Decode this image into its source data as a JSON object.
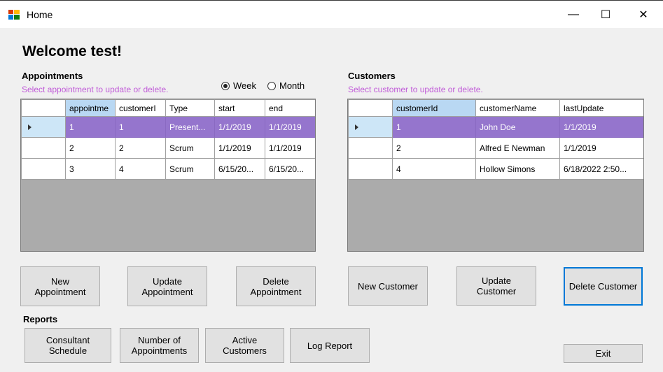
{
  "window": {
    "title": "Home",
    "minimize": "—",
    "maximize": "☐",
    "close": "✕"
  },
  "welcome": "Welcome test!",
  "appointments": {
    "title": "Appointments",
    "hint": "Select appointment to update or delete.",
    "columns": [
      "appointme",
      "customerI",
      "Type",
      "start",
      "end"
    ],
    "rows": [
      [
        "1",
        "1",
        "Present...",
        "1/1/2019",
        "1/1/2019"
      ],
      [
        "2",
        "2",
        "Scrum",
        "1/1/2019",
        "1/1/2019"
      ],
      [
        "3",
        "4",
        "Scrum",
        "6/15/20...",
        "6/15/20..."
      ]
    ]
  },
  "view_toggle": {
    "week": "Week",
    "month": "Month",
    "selected": "Week"
  },
  "customers": {
    "title": "Customers",
    "hint": "Select customer to update or delete.",
    "columns": [
      "customerId",
      "customerName",
      "lastUpdate"
    ],
    "rows": [
      [
        "1",
        "John Doe",
        "1/1/2019"
      ],
      [
        "2",
        "Alfred E Newman",
        "1/1/2019"
      ],
      [
        "4",
        "Hollow Simons",
        "6/18/2022 2:50..."
      ]
    ]
  },
  "buttons": {
    "new_appointment": [
      "New",
      "Appointment"
    ],
    "update_appointment": [
      "Update",
      "Appointment"
    ],
    "delete_appointment": [
      "Delete",
      "Appointment"
    ],
    "new_customer": "New Customer",
    "update_customer": [
      "Update",
      "Customer"
    ],
    "delete_customer": "Delete Customer",
    "exit": "Exit"
  },
  "reports": {
    "title": "Reports",
    "consultant_schedule": [
      "Consultant",
      "Schedule"
    ],
    "number_of_appointments": [
      "Number of",
      "Appointments"
    ],
    "active_customers": [
      "Active",
      "Customers"
    ],
    "log_report": "Log Report"
  },
  "colors": {
    "selected_row": "#9575cd",
    "hint": "#c05ad8",
    "header_selected": "#b9d8f3",
    "focus_border": "#0078d7"
  }
}
